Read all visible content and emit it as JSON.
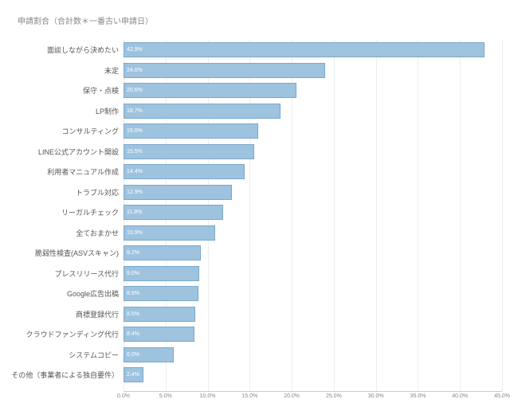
{
  "title": "申請割合（合計数＊一番古い申請日）",
  "chart_data": {
    "type": "bar",
    "orientation": "horizontal",
    "title": "申請割合（合計数＊一番古い申請日）",
    "xlabel": "",
    "ylabel": "",
    "xlim": [
      0,
      45
    ],
    "categories": [
      "面談しながら決めたい",
      "未定",
      "保守・点検",
      "LP制作",
      "コンサルティング",
      "LINE公式アカウント開設",
      "利用者マニュアル作成",
      "トラブル対応",
      "リーガルチェック",
      "全ておまかせ",
      "脆弱性検査(ASVスキャン)",
      "プレスリリース代行",
      "Google広告出稿",
      "商標登録代行",
      "クラウドファンディング代行",
      "システムコピー",
      "その他（事業者による独自要件）"
    ],
    "values": [
      42.9,
      24.0,
      20.6,
      18.7,
      16.0,
      15.5,
      14.4,
      12.9,
      11.8,
      10.9,
      9.2,
      9.0,
      8.9,
      8.5,
      8.4,
      6.0,
      2.4
    ],
    "value_suffix": "%",
    "ticks": [
      0.0,
      5.0,
      10.0,
      15.0,
      20.0,
      25.0,
      30.0,
      35.0,
      40.0,
      45.0
    ]
  }
}
